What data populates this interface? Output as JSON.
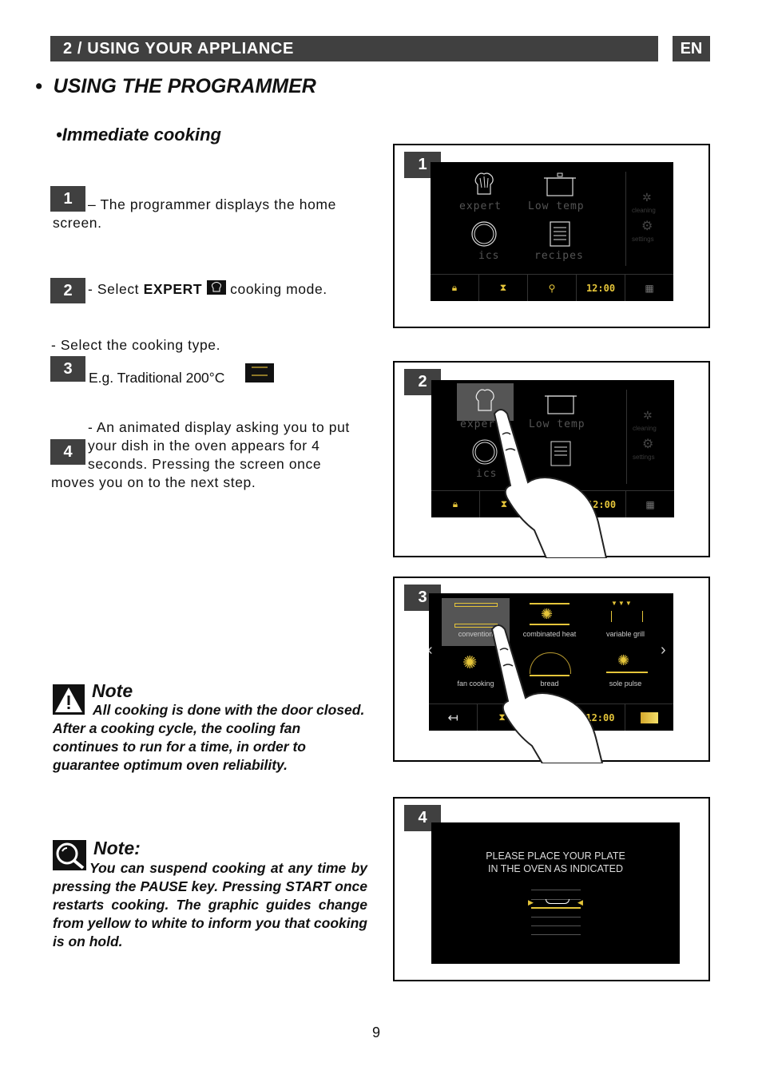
{
  "header": {
    "section": "2 / USING YOUR APPLIANCE",
    "lang": "EN"
  },
  "title": "USING THE PROGRAMMER",
  "subtitle": "Immediate cooking",
  "bullet": "•",
  "steps": [
    {
      "num": "1",
      "text": "– The programmer displays the home screen."
    },
    {
      "num": "2",
      "text_before": "- Select ",
      "bold": "EXPERT",
      "text_after": " cooking mode."
    },
    {
      "num": "3",
      "pre_line": "- Select the cooking type.",
      "text": "E.g. Traditional 200°C"
    },
    {
      "num": "4",
      "text": "- An animated display asking you to put your dish in the oven appears for 4 seconds. Pressing the screen once moves you on to the next step."
    }
  ],
  "note1": {
    "icon": "warning-icon",
    "title": "Note",
    "text": "All cooking is done with the door closed. After a cooking cycle, the cooling fan continues to run for a time, in order to guarantee optimum oven reliability."
  },
  "note2": {
    "icon": "magnifier-icon",
    "title": "Note:",
    "text": "You can suspend cooking at any time by pressing the PAUSE key.  Pressing START once restarts cooking. The graphic guides change from yellow to white to inform you that cooking is on hold."
  },
  "figures": [
    {
      "num": "1",
      "home_modes": [
        "expert",
        "Low temp",
        "ics",
        "recipes"
      ],
      "side_items": [
        "cleaning",
        "settings"
      ],
      "bottom_bar": {
        "icons": [
          "lock-icon",
          "hourglass-icon",
          "search-icon",
          "clock",
          "grid-icon"
        ],
        "time": "12:00"
      }
    },
    {
      "num": "2",
      "home_modes": [
        "expert",
        "Low temp",
        "ics",
        "recipes"
      ],
      "side_items": [
        "cleaning",
        "settings"
      ],
      "bottom_bar": {
        "time": "12:00"
      }
    },
    {
      "num": "3",
      "cooking_types": [
        "convention",
        "combinated heat",
        "variable grill",
        "fan cooking",
        "bread",
        "sole pulse"
      ],
      "bottom_bar": {
        "time": "12:00"
      }
    },
    {
      "num": "4",
      "message_line1": "PLEASE PLACE YOUR PLATE",
      "message_line2": "IN THE OVEN AS INDICATED"
    }
  ],
  "colors": {
    "accent_yellow": "#e5c53a",
    "badge_gray": "#404040"
  },
  "page_number": "9"
}
